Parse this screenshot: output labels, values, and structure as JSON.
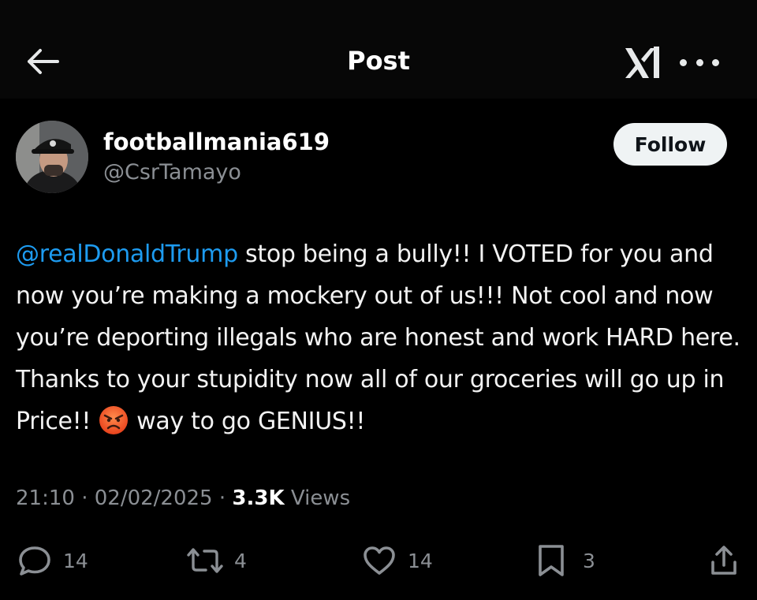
{
  "header": {
    "back_icon": "arrow-left-icon",
    "title": "Post",
    "logo_icon": "x-logo-icon",
    "more_icon": "more-horizontal-icon"
  },
  "author": {
    "display_name": "footballmania619",
    "handle": "@CsrTamayo",
    "follow_label": "Follow"
  },
  "post": {
    "mention": "@realDonaldTrump",
    "text_part1": " stop being a bully!! I VOTED for you and now you’re making a mockery out of us!!! Not cool and now you’re deporting illegals who are honest and work HARD here. Thanks to your stupidity now all of our groceries will go up in Price!!",
    "emoji": "angry-face-icon",
    "text_part2": "way to go GENIUS!!"
  },
  "meta": {
    "time": "21:10",
    "separator1": " · ",
    "date": "02/02/2025",
    "separator2": " · ",
    "views_count": "3.3K",
    "views_label": " Views"
  },
  "actions": {
    "replies": "14",
    "reposts": "4",
    "likes": "14",
    "bookmarks": "3"
  },
  "colors": {
    "background": "#000000",
    "mention": "#1d9bf0",
    "muted": "#8b8f94",
    "follow_bg": "#eff3f4"
  }
}
